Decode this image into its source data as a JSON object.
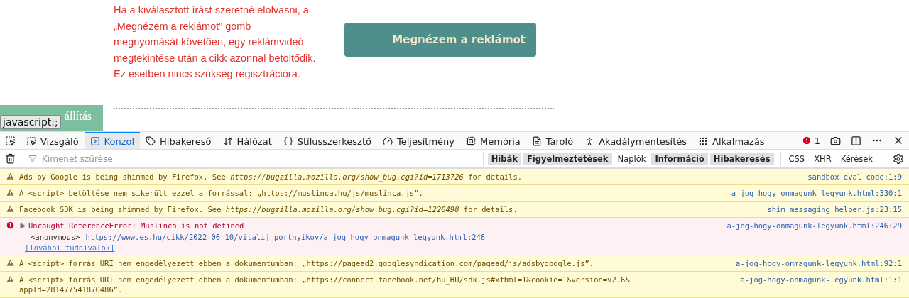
{
  "page": {
    "paragraph": "Ha a kiválasztott írást szeretné elolvasni, a „Megnézem a reklámot” gomb megnyomását követően, egy reklámvideó megtekintése után a cikk azonnal betöltődik. Ez esetben nincs szükség regisztrációra.",
    "ad_button": "Megnézem a reklámot",
    "cookie_button": "állítás",
    "status_tooltip": "javascript:;"
  },
  "devtools": {
    "tabs": [
      {
        "label": "Vizsgáló",
        "selected": false
      },
      {
        "label": "Konzol",
        "selected": true
      },
      {
        "label": "Hibakereső",
        "selected": false
      },
      {
        "label": "Hálózat",
        "selected": false
      },
      {
        "label": "Stílusszerkesztő",
        "selected": false
      },
      {
        "label": "Teljesítmény",
        "selected": false
      },
      {
        "label": "Memória",
        "selected": false
      },
      {
        "label": "Tároló",
        "selected": false
      },
      {
        "label": "Akadálymentesítés",
        "selected": false
      },
      {
        "label": "Alkalmazás",
        "selected": false
      }
    ],
    "error_count": "1",
    "filter": {
      "placeholder": "Kimenet szűrése"
    },
    "levels": [
      {
        "label": "Hibák",
        "selected": true
      },
      {
        "label": "Figyelmeztetések",
        "selected": true
      },
      {
        "label": "Naplók",
        "selected": false
      },
      {
        "label": "Információ",
        "selected": true
      },
      {
        "label": "Hibakeresés",
        "selected": true
      }
    ],
    "types": [
      {
        "label": "CSS",
        "selected": false
      },
      {
        "label": "XHR",
        "selected": false
      },
      {
        "label": "Kérések",
        "selected": false
      }
    ],
    "messages": [
      {
        "kind": "warning",
        "text": "Ads by Google is being shimmed by Firefox. See *https://bugzilla.mozilla.org/show_bug.cgi?id=1713726* for details.",
        "source": "sandbox eval code:1:9"
      },
      {
        "kind": "warning",
        "text": "A <script> betöltése nem sikerült ezzel a forrással: „https://muslinca.hu/js/muslinca.js”.",
        "source": "a-jog-hogy-onmagunk-legyunk.html:330:1"
      },
      {
        "kind": "warning",
        "text": "Facebook SDK is being shimmed by Firefox. See *https://bugzilla.mozilla.org/show_bug.cgi?id=1226498* for details.",
        "source": "shim_messaging_helper.js:23:15"
      },
      {
        "kind": "error",
        "text": "Uncaught ReferenceError: Muslinca is not defined",
        "source": "a-jog-hogy-onmagunk-legyunk.html:246:29",
        "expanded": false,
        "stack": {
          "fn": "<anonymous>",
          "url": "https://www.es.hu/cikk/2022-06-10/vitalij-portnyikov/a-jog-hogy-onmagunk-legyunk.html:246"
        },
        "more_link": "[További tudnivalók]"
      },
      {
        "kind": "warning",
        "text": "A <script> forrás URI nem engedélyezett ebben a dokumentumban: „https://pagead2.googlesyndication.com/pagead/js/adsbygoogle.js”.",
        "source": "a-jog-hogy-onmagunk-legyunk.html:92:1"
      },
      {
        "kind": "warning",
        "text": "A <script> forrás URI nem engedélyezett ebben a dokumentumban: „https://connect.facebook.net/hu_HU/sdk.js#xfbml=1&cookie=1&version=v2.6& appId=281477541870486”.",
        "source": "a-jog-hogy-onmagunk-legyunk.html:1:1"
      }
    ]
  }
}
